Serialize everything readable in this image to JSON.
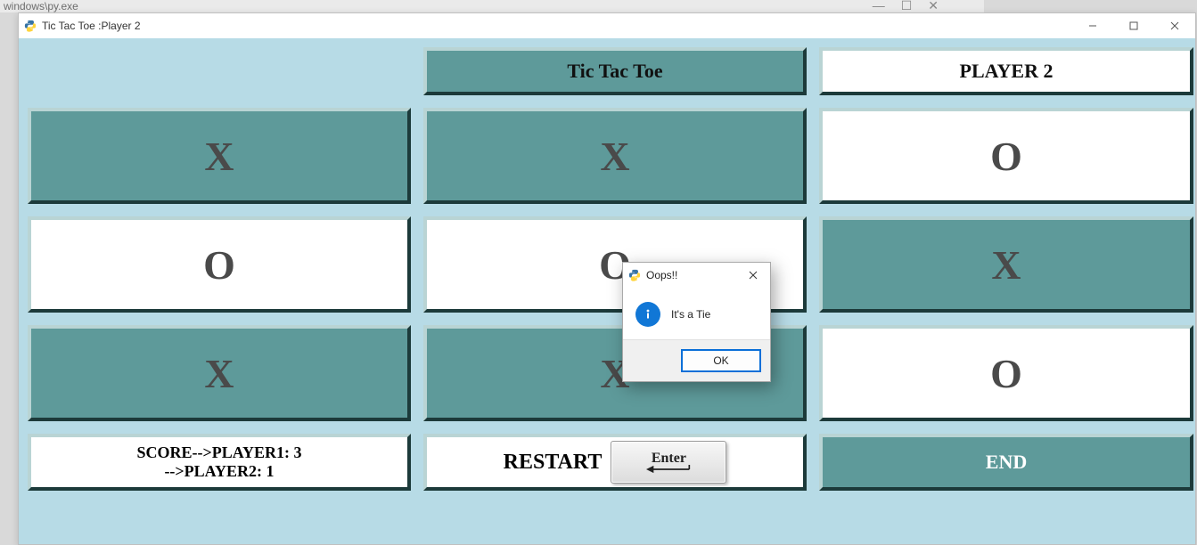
{
  "bg_window": {
    "path": "windows\\py.exe"
  },
  "window": {
    "title": "Tic Tac Toe :Player 2",
    "controls": {
      "min": "–",
      "max": "▢",
      "close": "✕"
    }
  },
  "header": {
    "title": "Tic Tac Toe",
    "player": "PLAYER 2"
  },
  "board": {
    "cells": [
      "X",
      "X",
      "O",
      "O",
      "O",
      "X",
      "X",
      "X",
      "O"
    ],
    "style": [
      "teal",
      "teal",
      "white",
      "white",
      "white",
      "teal",
      "teal",
      "teal",
      "white"
    ]
  },
  "footer": {
    "score_line1": "SCORE-->PLAYER1: 3",
    "score_line2": "-->PLAYER2: 1",
    "restart_label": "RESTART",
    "enter_label": "Enter",
    "end_label": "END"
  },
  "dialog": {
    "title": "Oops!!",
    "message": "It's a Tie",
    "ok": "OK"
  }
}
